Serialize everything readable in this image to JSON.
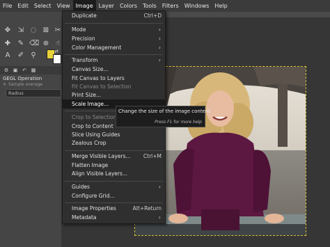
{
  "menubar": {
    "items": [
      {
        "label": "File"
      },
      {
        "label": "Edit"
      },
      {
        "label": "Select"
      },
      {
        "label": "View"
      },
      {
        "label": "Image"
      },
      {
        "label": "Layer"
      },
      {
        "label": "Colors"
      },
      {
        "label": "Tools"
      },
      {
        "label": "Filters"
      },
      {
        "label": "Windows"
      },
      {
        "label": "Help"
      }
    ]
  },
  "dock": {
    "gegl_title": "GEGL Operation",
    "sample_average": "Sample average",
    "radius_label": "Radius",
    "foreground_color": "#e8d23a",
    "background_color": "#ffffff"
  },
  "image_menu": {
    "items": [
      {
        "label": "Duplicate",
        "accel": "Ctrl+D"
      },
      {
        "label": "Mode"
      },
      {
        "label": "Precision"
      },
      {
        "label": "Color Management"
      },
      {
        "label": "Transform"
      },
      {
        "label": "Canvas Size..."
      },
      {
        "label": "Fit Canvas to Layers"
      },
      {
        "label": "Fit Canvas to Selection"
      },
      {
        "label": "Print Size..."
      },
      {
        "label": "Scale Image..."
      },
      {
        "label": "Crop to Selection"
      },
      {
        "label": "Crop to Content"
      },
      {
        "label": "Slice Using Guides"
      },
      {
        "label": "Zealous Crop"
      },
      {
        "label": "Merge Visible Layers...",
        "accel": "Ctrl+M"
      },
      {
        "label": "Flatten Image"
      },
      {
        "label": "Align Visible Layers..."
      },
      {
        "label": "Guides"
      },
      {
        "label": "Configure Grid..."
      },
      {
        "label": "Image Properties",
        "accel": "Alt+Return"
      },
      {
        "label": "Metadata"
      }
    ]
  },
  "tooltip": {
    "text": "Change the size of the image content",
    "help": "Press F1 for more help"
  }
}
